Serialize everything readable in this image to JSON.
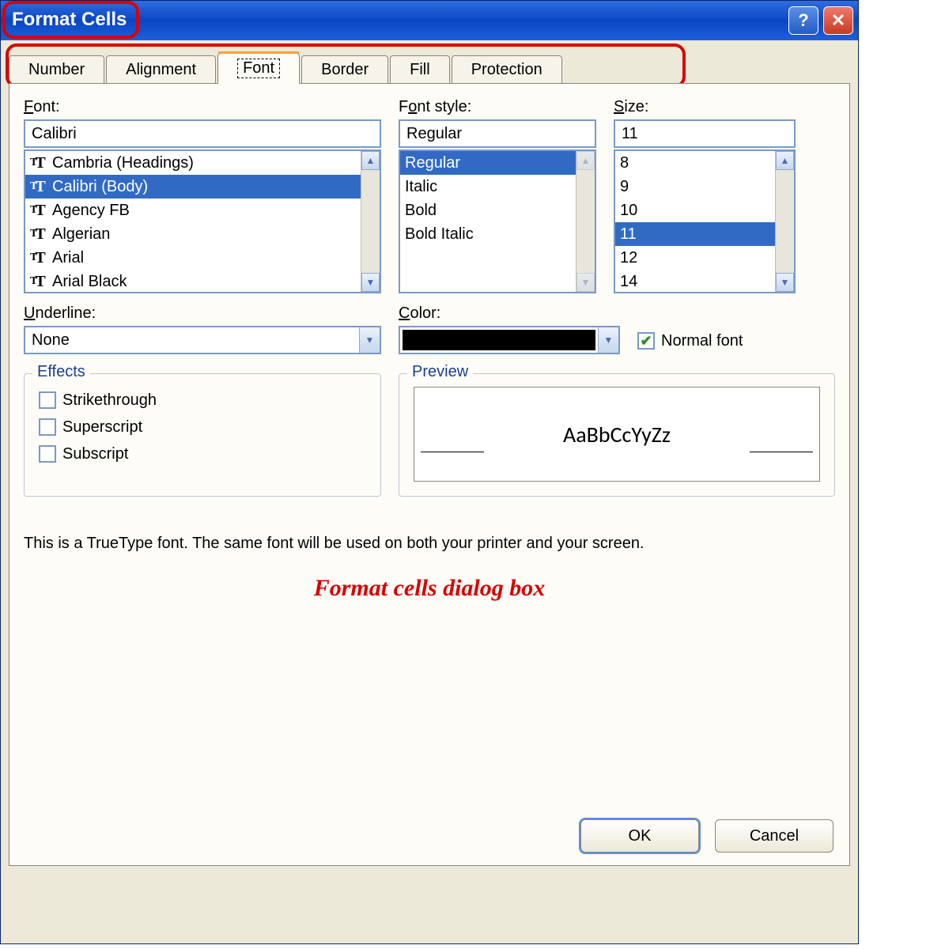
{
  "title": "Format Cells",
  "tabs": [
    "Number",
    "Alignment",
    "Font",
    "Border",
    "Fill",
    "Protection"
  ],
  "active_tab_index": 2,
  "font": {
    "label": "Font:",
    "value": "Calibri",
    "items": [
      "Cambria (Headings)",
      "Calibri (Body)",
      "Agency FB",
      "Algerian",
      "Arial",
      "Arial Black"
    ],
    "selected_index": 1
  },
  "font_style": {
    "label": "Font style:",
    "value": "Regular",
    "items": [
      "Regular",
      "Italic",
      "Bold",
      "Bold Italic"
    ],
    "selected_index": 0
  },
  "size": {
    "label": "Size:",
    "value": "11",
    "items": [
      "8",
      "9",
      "10",
      "11",
      "12",
      "14"
    ],
    "selected_index": 3
  },
  "underline": {
    "label": "Underline:",
    "value": "None"
  },
  "color": {
    "label": "Color:",
    "value_hex": "#000000"
  },
  "normal_font": {
    "label": "Normal font",
    "checked": true
  },
  "effects": {
    "legend": "Effects",
    "items": [
      {
        "label": "Strikethrough",
        "checked": false
      },
      {
        "label": "Superscript",
        "checked": false
      },
      {
        "label": "Subscript",
        "checked": false
      }
    ]
  },
  "preview": {
    "legend": "Preview",
    "sample": "AaBbCcYyZz"
  },
  "description": "This is a TrueType font.  The same font will be used on both your printer and your screen.",
  "caption": "Format cells dialog box",
  "buttons": {
    "ok": "OK",
    "cancel": "Cancel"
  }
}
